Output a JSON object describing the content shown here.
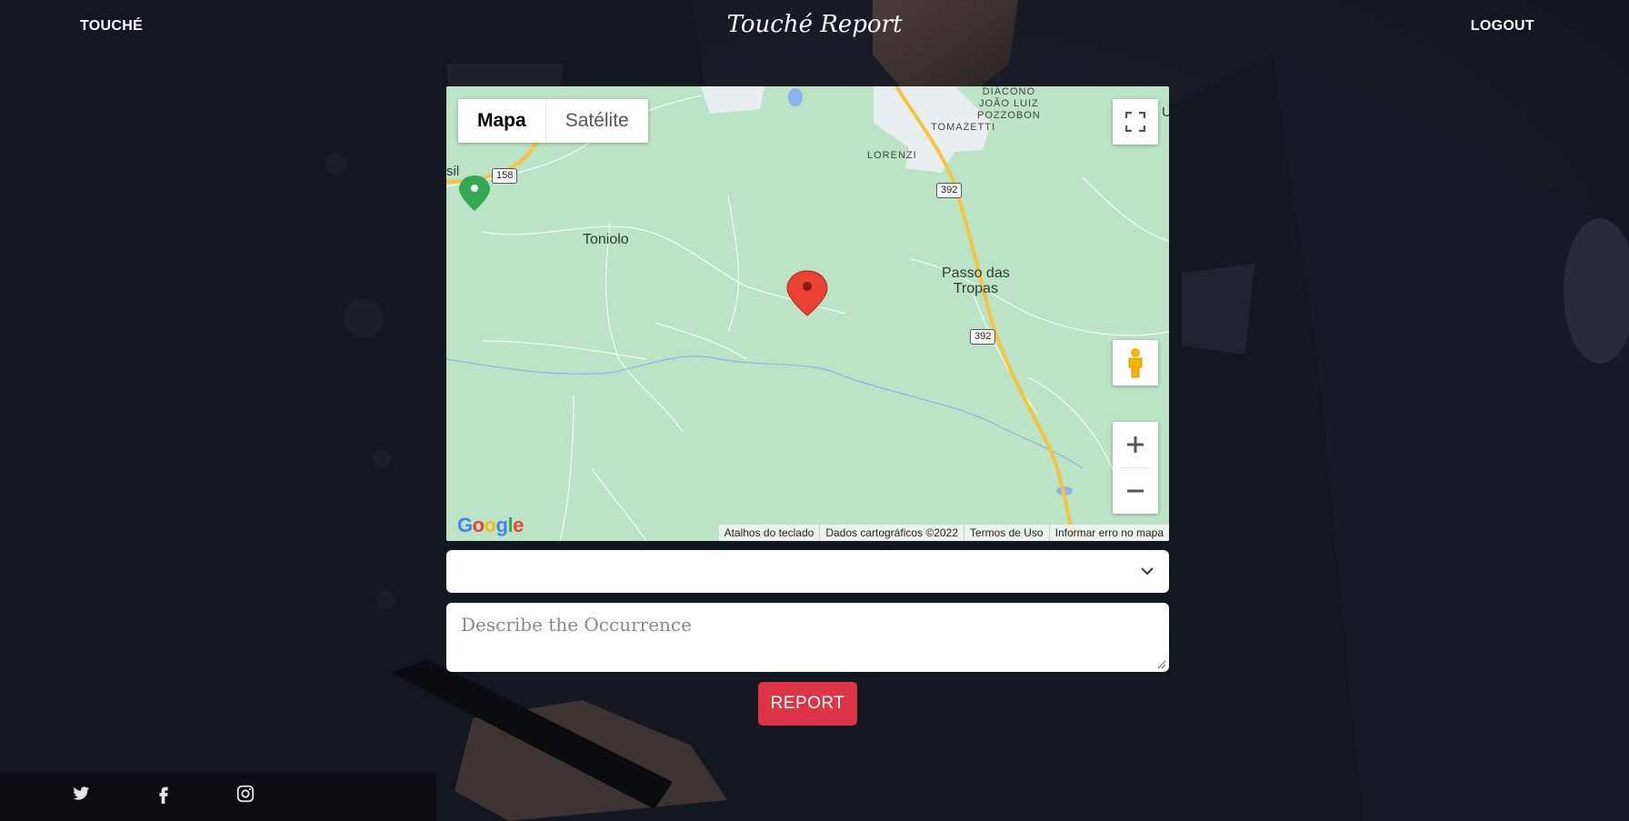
{
  "nav": {
    "brand": "TOUCHÉ",
    "title": "Touché Report",
    "logout": "LOGOUT"
  },
  "map": {
    "map_type_options": [
      "Mapa",
      "Satélite"
    ],
    "selected_map_type": "Mapa",
    "places": {
      "toniolo": "Toniolo",
      "passo_das_tropas": "Passo das\nTropas",
      "lorenzi": "LORENZI",
      "tomazetti": "TOMAZETTI",
      "diacono": "DIÁCONO\nJOÃO LUIZ\nPOZZOBON",
      "partial_left": "sil",
      "partial_right": "U"
    },
    "route_shields": [
      "158",
      "392",
      "392"
    ],
    "logo": "Google",
    "attribution": [
      "Atalhos do teclado",
      "Dados cartográficos ©2022",
      "Termos de Uso",
      "Informar erro no mapa"
    ],
    "colors": {
      "land": "#bce3c5",
      "marker": "#ea4335",
      "highway": "#f5c542"
    }
  },
  "form": {
    "select_value": "",
    "description_placeholder": "Describe the Occurrence",
    "report_button": "REPORT"
  },
  "footer": {
    "social_icons": [
      "twitter-icon",
      "facebook-icon",
      "instagram-icon"
    ]
  },
  "colors": {
    "accent": "#dc3545",
    "text": "#ffffff"
  }
}
